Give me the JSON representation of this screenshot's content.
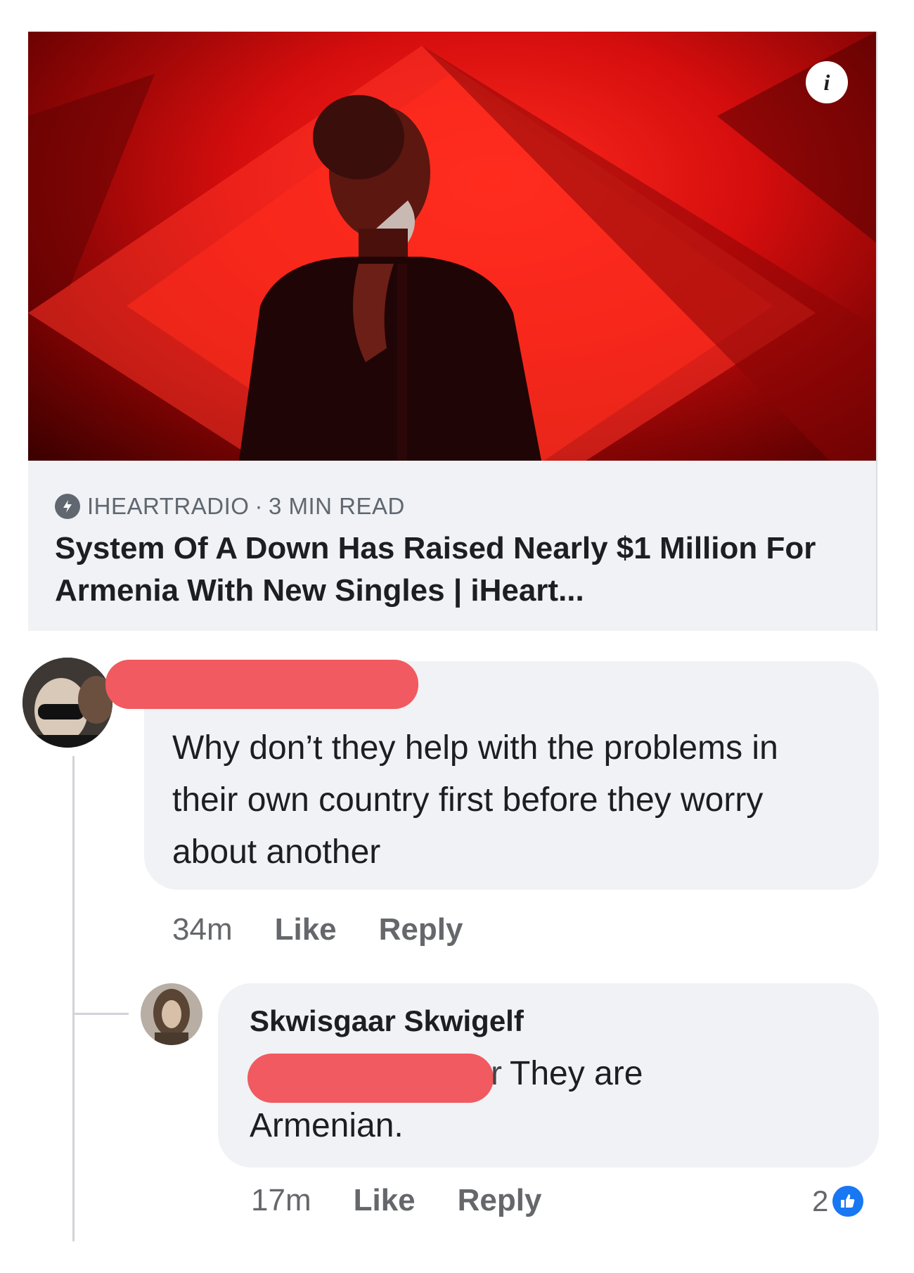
{
  "link_preview": {
    "info_icon": "info-icon",
    "source": "IHEARTRADIO",
    "separator": "·",
    "read_time": "3 MIN READ",
    "headline": "System Of A Down Has Raised Nearly $1 Million For Armenia With New Singles | iHeart..."
  },
  "comments": [
    {
      "author": "",
      "text": "Why don’t they help with the problems in their own country first before they worry about another",
      "time": "34m",
      "like_label": "Like",
      "reply_label": "Reply"
    },
    {
      "author": "Skwisgaar Skwigelf",
      "mention_suffix": "r",
      "text_line1": "They are",
      "text_line2": "Armenian.",
      "time": "17m",
      "like_label": "Like",
      "reply_label": "Reply",
      "reaction_count": "2",
      "reaction_icon": "thumbs-up-icon"
    }
  ],
  "colors": {
    "bubble": "#f0f2f5",
    "redaction": "#f05a60",
    "like_blue": "#1877f2",
    "hero_red": "#e0120f"
  }
}
